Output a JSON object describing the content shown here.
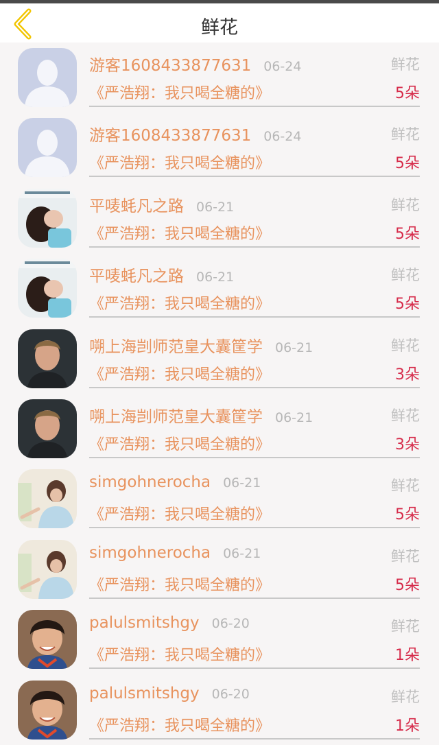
{
  "header": {
    "title": "鲜花",
    "back_icon": "chevron-left-icon",
    "back_color": "#f2c500"
  },
  "colors": {
    "username": "#e8935e",
    "article": "#e8935e",
    "count": "#d62b4a",
    "meta": "#b7b7b7"
  },
  "rows": [
    {
      "username": "游客1608433877631",
      "date": "06-24",
      "gift": "鲜花",
      "article": "《严浩翔：我只喝全糖的》",
      "count": "5朵",
      "avatar": "default-avatar"
    },
    {
      "username": "游客1608433877631",
      "date": "06-24",
      "gift": "鲜花",
      "article": "《严浩翔：我只喝全糖的》",
      "count": "5朵",
      "avatar": "default-avatar"
    },
    {
      "username": "平唛蚝凡之路",
      "date": "06-21",
      "gift": "鲜花",
      "article": "《严浩翔：我只喝全糖的》",
      "count": "5朵",
      "avatar": "photo-girl"
    },
    {
      "username": "平唛蚝凡之路",
      "date": "06-21",
      "gift": "鲜花",
      "article": "《严浩翔：我只喝全糖的》",
      "count": "5朵",
      "avatar": "photo-girl"
    },
    {
      "username": "嗍上海剀师范皇大囊筐学",
      "date": "06-21",
      "gift": "鲜花",
      "article": "《严浩翔：我只喝全糖的》",
      "count": "3朵",
      "avatar": "photo-boy-dark"
    },
    {
      "username": "嗍上海剀师范皇大囊筐学",
      "date": "06-21",
      "gift": "鲜花",
      "article": "《严浩翔：我只喝全糖的》",
      "count": "3朵",
      "avatar": "photo-boy-dark"
    },
    {
      "username": "simgohnerocha",
      "date": "06-21",
      "gift": "鲜花",
      "article": "《严浩翔：我只喝全糖的》",
      "count": "5朵",
      "avatar": "photo-child-light"
    },
    {
      "username": "simgohnerocha",
      "date": "06-21",
      "gift": "鲜花",
      "article": "《严浩翔：我只喝全糖的》",
      "count": "5朵",
      "avatar": "photo-child-light"
    },
    {
      "username": "palulsmitshgy",
      "date": "06-20",
      "gift": "鲜花",
      "article": "《严浩翔：我只喝全糖的》",
      "count": "1朵",
      "avatar": "photo-boy-smile"
    },
    {
      "username": "palulsmitshgy",
      "date": "06-20",
      "gift": "鲜花",
      "article": "《严浩翔：我只喝全糖的》",
      "count": "1朵",
      "avatar": "photo-boy-smile"
    }
  ]
}
